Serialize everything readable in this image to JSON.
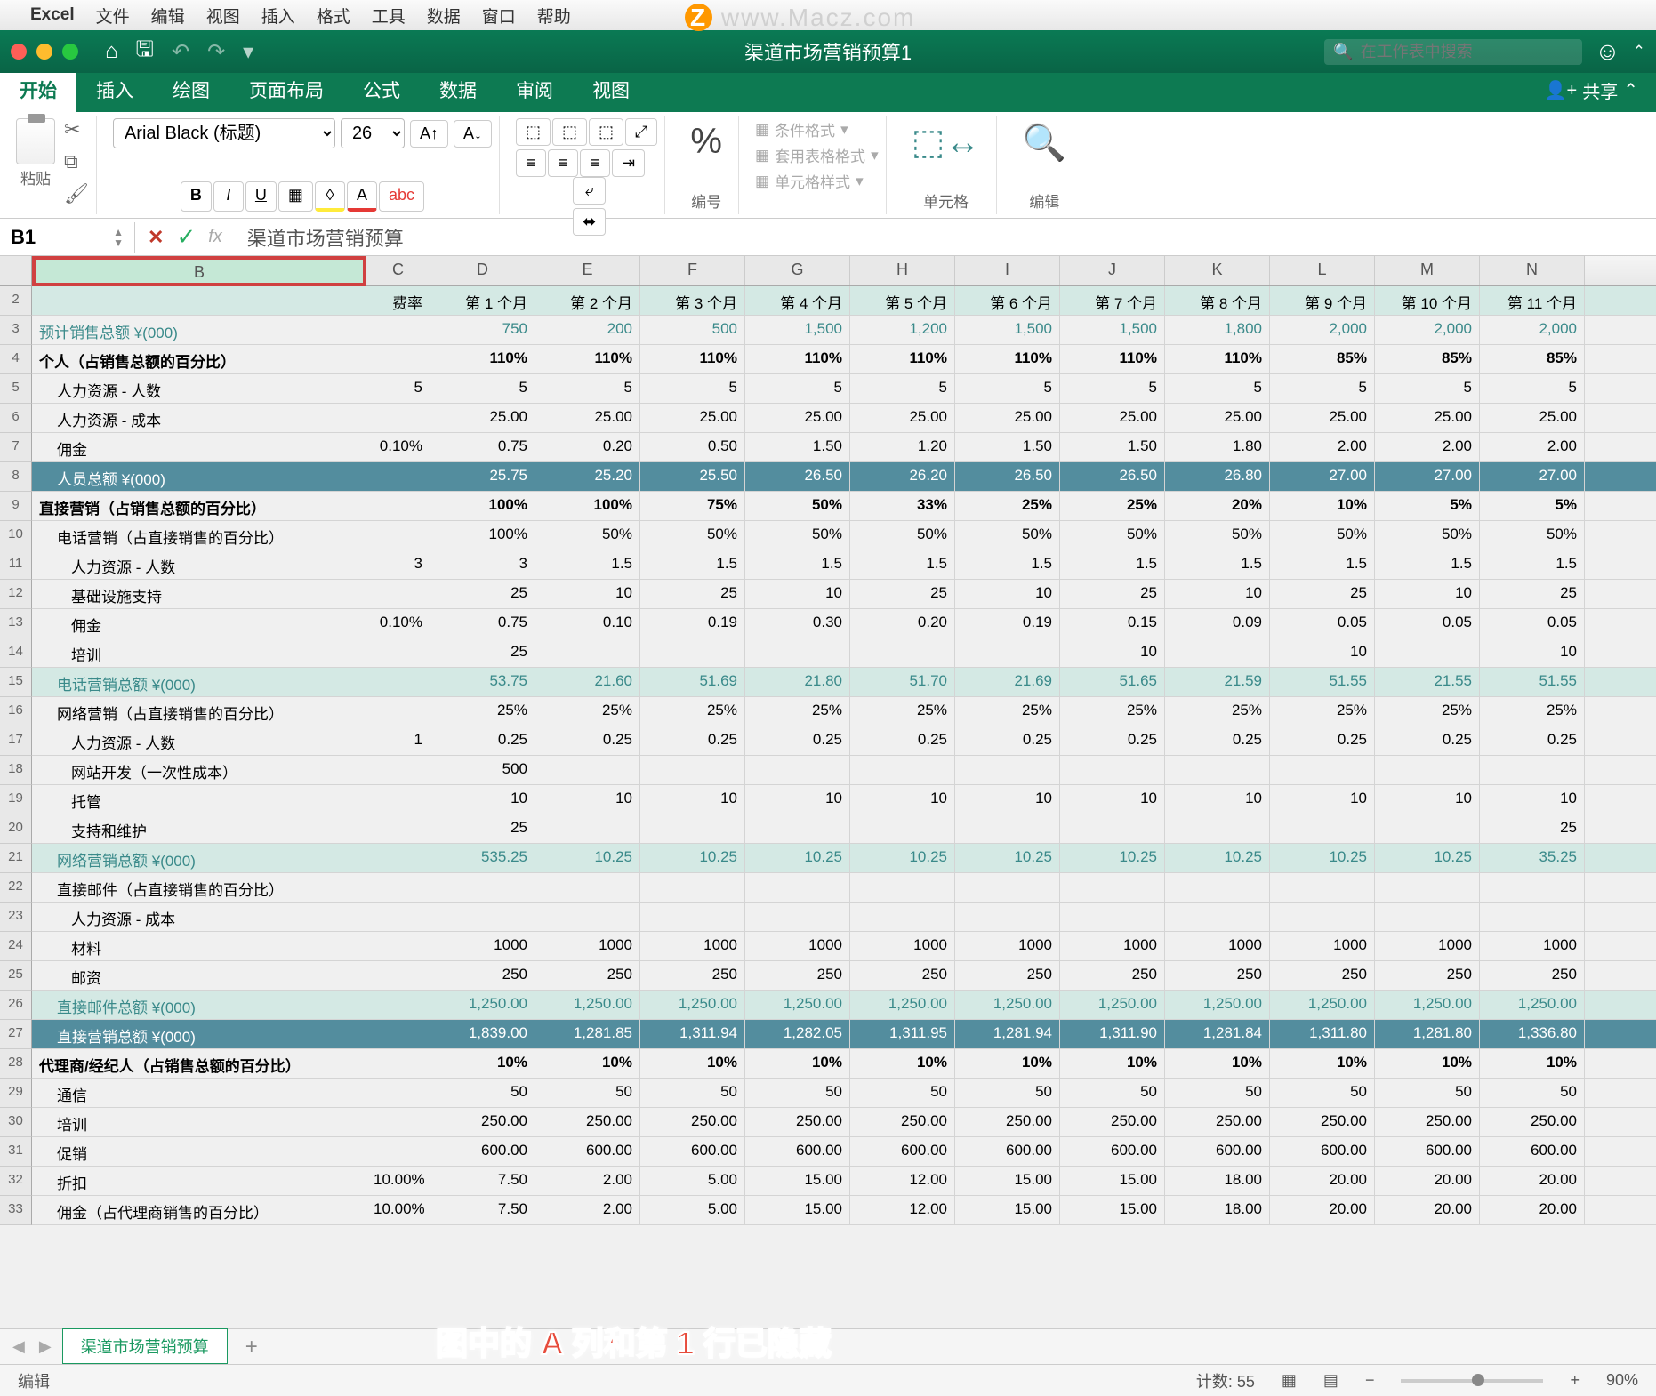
{
  "menubar": {
    "app": "Excel",
    "items": [
      "文件",
      "编辑",
      "视图",
      "插入",
      "格式",
      "工具",
      "数据",
      "窗口",
      "帮助"
    ]
  },
  "watermark": "www.Macz.com",
  "titlebar": {
    "title": "渠道市场营销预算1",
    "search_placeholder": "在工作表中搜索"
  },
  "tabs": {
    "items": [
      "开始",
      "插入",
      "绘图",
      "页面布局",
      "公式",
      "数据",
      "审阅",
      "视图"
    ],
    "active": 0,
    "share": "共享"
  },
  "ribbon": {
    "paste": "粘贴",
    "font": "Arial Black (标题)",
    "size": "26",
    "number": "编号",
    "cells": "单元格",
    "editing": "编辑",
    "cond_format": "条件格式",
    "table_format": "套用表格格式",
    "cell_styles": "单元格样式"
  },
  "namebox": {
    "ref": "B1",
    "formula": "渠道市场营销预算"
  },
  "columns": [
    "B",
    "C",
    "D",
    "E",
    "F",
    "G",
    "H",
    "I",
    "J",
    "K",
    "L",
    "M",
    "N"
  ],
  "col_period_labels": [
    "费率",
    "第 1 个月",
    "第 2 个月",
    "第 3 个月",
    "第 4 个月",
    "第 5 个月",
    "第 6 个月",
    "第 7 个月",
    "第 8 个月",
    "第 9 个月",
    "第 10 个月",
    "第 11 个月"
  ],
  "rows": [
    {
      "n": 2,
      "cls": "row-header-teal",
      "b": "",
      "vals": [
        "费率",
        "第 1 个月",
        "第 2 个月",
        "第 3 个月",
        "第 4 个月",
        "第 5 个月",
        "第 6 个月",
        "第 7 个月",
        "第 8 个月",
        "第 9 个月",
        "第 10 个月",
        "第 11 个月"
      ]
    },
    {
      "n": 3,
      "cls": "row-teal-text",
      "b": "预计销售总额 ¥(000)",
      "vals": [
        "",
        "750",
        "200",
        "500",
        "1,500",
        "1,200",
        "1,500",
        "1,500",
        "1,800",
        "2,000",
        "2,000",
        "2,000"
      ]
    },
    {
      "n": 4,
      "cls": "row-bold",
      "b": "个人（占销售总额的百分比）",
      "vals": [
        "",
        "110%",
        "110%",
        "110%",
        "110%",
        "110%",
        "110%",
        "110%",
        "110%",
        "85%",
        "85%",
        "85%"
      ]
    },
    {
      "n": 5,
      "cls": "",
      "b": "人力资源 - 人数",
      "indent": 1,
      "vals": [
        "5",
        "5",
        "5",
        "5",
        "5",
        "5",
        "5",
        "5",
        "5",
        "5",
        "5",
        "5"
      ]
    },
    {
      "n": 6,
      "cls": "",
      "b": "人力资源 - 成本",
      "indent": 1,
      "vals": [
        "",
        "25.00",
        "25.00",
        "25.00",
        "25.00",
        "25.00",
        "25.00",
        "25.00",
        "25.00",
        "25.00",
        "25.00",
        "25.00"
      ]
    },
    {
      "n": 7,
      "cls": "",
      "b": "佣金",
      "indent": 1,
      "vals": [
        "0.10%",
        "0.75",
        "0.20",
        "0.50",
        "1.50",
        "1.20",
        "1.50",
        "1.50",
        "1.80",
        "2.00",
        "2.00",
        "2.00"
      ]
    },
    {
      "n": 8,
      "cls": "row-total",
      "b": "人员总额 ¥(000)",
      "indent": 1,
      "vals": [
        "",
        "25.75",
        "25.20",
        "25.50",
        "26.50",
        "26.20",
        "26.50",
        "26.50",
        "26.80",
        "27.00",
        "27.00",
        "27.00"
      ]
    },
    {
      "n": 9,
      "cls": "row-bold",
      "b": "直接营销（占销售总额的百分比）",
      "vals": [
        "",
        "100%",
        "100%",
        "75%",
        "50%",
        "33%",
        "25%",
        "25%",
        "20%",
        "10%",
        "5%",
        "5%"
      ]
    },
    {
      "n": 10,
      "cls": "",
      "b": "电话营销（占直接销售的百分比）",
      "indent": 1,
      "vals": [
        "",
        "100%",
        "50%",
        "50%",
        "50%",
        "50%",
        "50%",
        "50%",
        "50%",
        "50%",
        "50%",
        "50%"
      ]
    },
    {
      "n": 11,
      "cls": "",
      "b": "人力资源 - 人数",
      "indent": 2,
      "vals": [
        "3",
        "3",
        "1.5",
        "1.5",
        "1.5",
        "1.5",
        "1.5",
        "1.5",
        "1.5",
        "1.5",
        "1.5",
        "1.5"
      ]
    },
    {
      "n": 12,
      "cls": "",
      "b": "基础设施支持",
      "indent": 2,
      "vals": [
        "",
        "25",
        "10",
        "25",
        "10",
        "25",
        "10",
        "25",
        "10",
        "25",
        "10",
        "25"
      ]
    },
    {
      "n": 13,
      "cls": "",
      "b": "佣金",
      "indent": 2,
      "vals": [
        "0.10%",
        "0.75",
        "0.10",
        "0.19",
        "0.30",
        "0.20",
        "0.19",
        "0.15",
        "0.09",
        "0.05",
        "0.05",
        "0.05"
      ]
    },
    {
      "n": 14,
      "cls": "",
      "b": "培训",
      "indent": 2,
      "vals": [
        "",
        "25",
        "",
        "",
        "",
        "",
        "",
        "10",
        "",
        "10",
        "",
        "10"
      ]
    },
    {
      "n": 15,
      "cls": "row-teal-text row-header-teal",
      "b": "电话营销总额 ¥(000)",
      "indent": 1,
      "vals": [
        "",
        "53.75",
        "21.60",
        "51.69",
        "21.80",
        "51.70",
        "21.69",
        "51.65",
        "21.59",
        "51.55",
        "21.55",
        "51.55"
      ]
    },
    {
      "n": 16,
      "cls": "",
      "b": "网络营销（占直接销售的百分比）",
      "indent": 1,
      "vals": [
        "",
        "25%",
        "25%",
        "25%",
        "25%",
        "25%",
        "25%",
        "25%",
        "25%",
        "25%",
        "25%",
        "25%"
      ]
    },
    {
      "n": 17,
      "cls": "",
      "b": "人力资源 - 人数",
      "indent": 2,
      "vals": [
        "1",
        "0.25",
        "0.25",
        "0.25",
        "0.25",
        "0.25",
        "0.25",
        "0.25",
        "0.25",
        "0.25",
        "0.25",
        "0.25"
      ]
    },
    {
      "n": 18,
      "cls": "",
      "b": "网站开发（一次性成本）",
      "indent": 2,
      "vals": [
        "",
        "500",
        "",
        "",
        "",
        "",
        "",
        "",
        "",
        "",
        "",
        ""
      ]
    },
    {
      "n": 19,
      "cls": "",
      "b": "托管",
      "indent": 2,
      "vals": [
        "",
        "10",
        "10",
        "10",
        "10",
        "10",
        "10",
        "10",
        "10",
        "10",
        "10",
        "10"
      ]
    },
    {
      "n": 20,
      "cls": "",
      "b": "支持和维护",
      "indent": 2,
      "vals": [
        "",
        "25",
        "",
        "",
        "",
        "",
        "",
        "",
        "",
        "",
        "",
        "25"
      ]
    },
    {
      "n": 21,
      "cls": "row-teal-text row-header-teal",
      "b": "网络营销总额 ¥(000)",
      "indent": 1,
      "vals": [
        "",
        "535.25",
        "10.25",
        "10.25",
        "10.25",
        "10.25",
        "10.25",
        "10.25",
        "10.25",
        "10.25",
        "10.25",
        "35.25"
      ]
    },
    {
      "n": 22,
      "cls": "",
      "b": "直接邮件（占直接销售的百分比）",
      "indent": 1,
      "vals": [
        "",
        "",
        "",
        "",
        "",
        "",
        "",
        "",
        "",
        "",
        "",
        ""
      ]
    },
    {
      "n": 23,
      "cls": "",
      "b": "人力资源 - 成本",
      "indent": 2,
      "vals": [
        "",
        "",
        "",
        "",
        "",
        "",
        "",
        "",
        "",
        "",
        "",
        ""
      ]
    },
    {
      "n": 24,
      "cls": "",
      "b": "材料",
      "indent": 2,
      "vals": [
        "",
        "1000",
        "1000",
        "1000",
        "1000",
        "1000",
        "1000",
        "1000",
        "1000",
        "1000",
        "1000",
        "1000"
      ]
    },
    {
      "n": 25,
      "cls": "",
      "b": "邮资",
      "indent": 2,
      "vals": [
        "",
        "250",
        "250",
        "250",
        "250",
        "250",
        "250",
        "250",
        "250",
        "250",
        "250",
        "250"
      ]
    },
    {
      "n": 26,
      "cls": "row-teal-text row-header-teal",
      "b": "直接邮件总额 ¥(000)",
      "indent": 1,
      "vals": [
        "",
        "1,250.00",
        "1,250.00",
        "1,250.00",
        "1,250.00",
        "1,250.00",
        "1,250.00",
        "1,250.00",
        "1,250.00",
        "1,250.00",
        "1,250.00",
        "1,250.00"
      ]
    },
    {
      "n": 27,
      "cls": "row-total",
      "b": "直接营销总额 ¥(000)",
      "indent": 1,
      "vals": [
        "",
        "1,839.00",
        "1,281.85",
        "1,311.94",
        "1,282.05",
        "1,311.95",
        "1,281.94",
        "1,311.90",
        "1,281.84",
        "1,311.80",
        "1,281.80",
        "1,336.80"
      ]
    },
    {
      "n": 28,
      "cls": "row-bold",
      "b": "代理商/经纪人（占销售总额的百分比）",
      "vals": [
        "",
        "10%",
        "10%",
        "10%",
        "10%",
        "10%",
        "10%",
        "10%",
        "10%",
        "10%",
        "10%",
        "10%"
      ]
    },
    {
      "n": 29,
      "cls": "",
      "b": "通信",
      "indent": 1,
      "vals": [
        "",
        "50",
        "50",
        "50",
        "50",
        "50",
        "50",
        "50",
        "50",
        "50",
        "50",
        "50"
      ]
    },
    {
      "n": 30,
      "cls": "",
      "b": "培训",
      "indent": 1,
      "vals": [
        "",
        "250.00",
        "250.00",
        "250.00",
        "250.00",
        "250.00",
        "250.00",
        "250.00",
        "250.00",
        "250.00",
        "250.00",
        "250.00"
      ]
    },
    {
      "n": 31,
      "cls": "",
      "b": "促销",
      "indent": 1,
      "vals": [
        "",
        "600.00",
        "600.00",
        "600.00",
        "600.00",
        "600.00",
        "600.00",
        "600.00",
        "600.00",
        "600.00",
        "600.00",
        "600.00"
      ]
    },
    {
      "n": 32,
      "cls": "",
      "b": "折扣",
      "indent": 1,
      "vals": [
        "10.00%",
        "7.50",
        "2.00",
        "5.00",
        "15.00",
        "12.00",
        "15.00",
        "15.00",
        "18.00",
        "20.00",
        "20.00",
        "20.00"
      ]
    },
    {
      "n": 33,
      "cls": "",
      "b": "佣金（占代理商销售的百分比）",
      "indent": 1,
      "vals": [
        "10.00%",
        "7.50",
        "2.00",
        "5.00",
        "15.00",
        "12.00",
        "15.00",
        "15.00",
        "18.00",
        "20.00",
        "20.00",
        "20.00"
      ]
    }
  ],
  "sheet": {
    "name": "渠道市场营销预算"
  },
  "annotation": "图中的 A 列和第 1 行已隐藏",
  "status": {
    "mode": "编辑",
    "count_label": "计数:",
    "count": "55",
    "zoom": "90%"
  }
}
